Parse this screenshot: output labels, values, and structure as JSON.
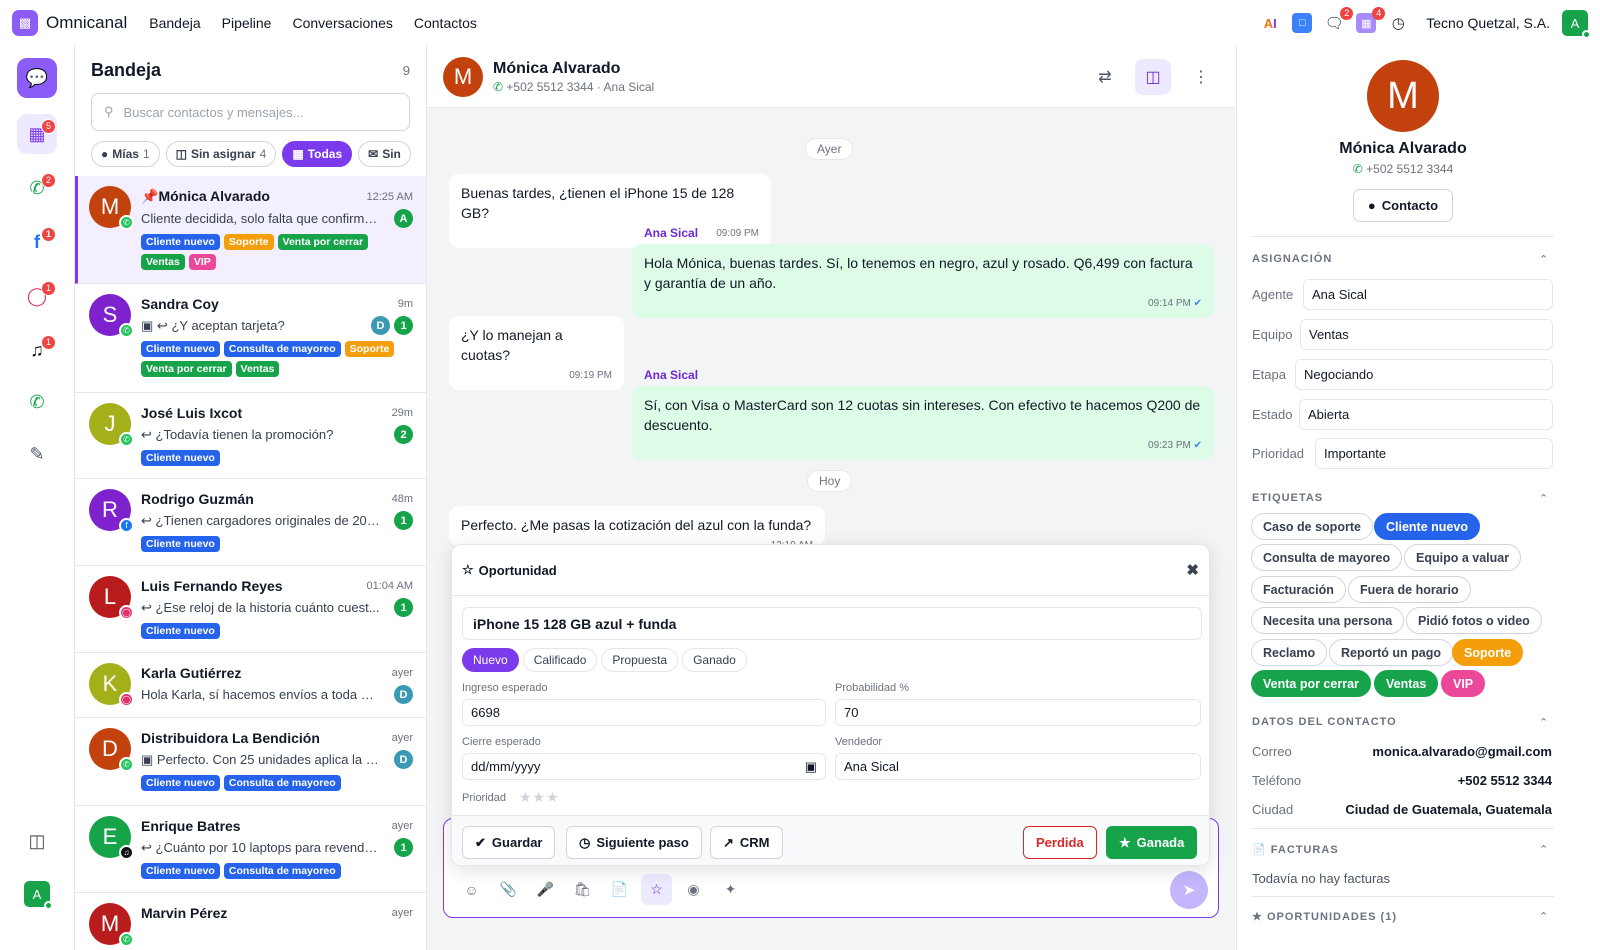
{
  "app": {
    "name": "Omnicanal",
    "company": "Tecno Quetzal, S.A.",
    "avatar_letter": "A",
    "brand_color": "#8b5cf6"
  },
  "topnav": [
    "Bandeja",
    "Pipeline",
    "Conversaciones",
    "Contactos"
  ],
  "top_badges": {
    "chat": "2",
    "apps": "4"
  },
  "rail_badges": {
    "inbox": "5",
    "whatsapp": "2",
    "facebook": "1",
    "instagram": "1",
    "tiktok": "1"
  },
  "inbox": {
    "title": "Bandeja",
    "count": "9",
    "search_placeholder": "Buscar contactos y mensajes...",
    "filters": [
      {
        "label": "Mías",
        "count": "1"
      },
      {
        "label": "Sin asignar",
        "count": "4"
      },
      {
        "label": "Todas",
        "count": ""
      },
      {
        "label": "Sin",
        "count": ""
      }
    ],
    "conversations": [
      {
        "name": "Mónica Alvarado",
        "time": "12:25 AM",
        "preview": "Cliente decidida, solo falta que confirme...",
        "avatar": "M",
        "color": "#c2410c",
        "channel": "whatsapp",
        "badge": "A",
        "tags": [
          [
            "Cliente nuevo",
            "blue"
          ],
          [
            "Soporte",
            "orange"
          ],
          [
            "Venta por cerrar",
            "green"
          ],
          [
            "Ventas",
            "green"
          ],
          [
            "VIP",
            "pink"
          ]
        ]
      },
      {
        "name": "Sandra Coy",
        "time": "9m",
        "preview": "¿Y aceptan tarjeta?",
        "avatar": "S",
        "color": "#7e22ce",
        "channel": "whatsapp",
        "badge": "D",
        "unread": "1",
        "tags": [
          [
            "Cliente nuevo",
            "blue"
          ],
          [
            "Consulta de mayoreo",
            "blue"
          ],
          [
            "Soporte",
            "orange"
          ],
          [
            "Venta por cerrar",
            "green"
          ],
          [
            "Ventas",
            "green"
          ]
        ]
      },
      {
        "name": "José Luis Ixcot",
        "time": "29m",
        "preview": "¿Todavía tienen la promoción?",
        "avatar": "J",
        "color": "#a3b01a",
        "channel": "whatsapp",
        "unread": "2",
        "tags": [
          [
            "Cliente nuevo",
            "blue"
          ]
        ]
      },
      {
        "name": "Rodrigo Guzmán",
        "time": "48m",
        "preview": "¿Tienen cargadores originales de 20 ...",
        "avatar": "R",
        "color": "#7e22ce",
        "channel": "facebook",
        "unread": "1",
        "tags": [
          [
            "Cliente nuevo",
            "blue"
          ]
        ]
      },
      {
        "name": "Luis Fernando Reyes",
        "time": "01:04 AM",
        "preview": "¿Ese reloj de la historia cuánto cuest...",
        "avatar": "L",
        "color": "#b91c1c",
        "channel": "instagram",
        "unread": "1",
        "tags": [
          [
            "Cliente nuevo",
            "blue"
          ]
        ]
      },
      {
        "name": "Karla Gutiérrez",
        "time": "ayer",
        "preview": "Hola Karla, sí hacemos envíos a toda Gu...",
        "avatar": "K",
        "color": "#a3b01a",
        "channel": "instagram",
        "badge": "D",
        "tags": []
      },
      {
        "name": "Distribuidora La Bendición",
        "time": "ayer",
        "preview": "Perfecto. Con 25 unidades aplica la lis...",
        "avatar": "D",
        "color": "#c2410c",
        "channel": "whatsapp",
        "badge": "D",
        "tags": [
          [
            "Cliente nuevo",
            "blue"
          ],
          [
            "Consulta de mayoreo",
            "blue"
          ]
        ]
      },
      {
        "name": "Enrique Batres",
        "time": "ayer",
        "preview": "¿Cuánto por 10 laptops para revende...",
        "avatar": "E",
        "color": "#16a34a",
        "channel": "tiktok",
        "unread": "1",
        "tags": [
          [
            "Cliente nuevo",
            "blue"
          ],
          [
            "Consulta de mayoreo",
            "blue"
          ]
        ]
      },
      {
        "name": "Marvin Pérez",
        "time": "ayer",
        "preview": "",
        "avatar": "M",
        "color": "#b91c1c",
        "channel": "whatsapp",
        "tags": []
      }
    ]
  },
  "chat": {
    "name": "Mónica Alvarado",
    "phone": "+502 5512 3344",
    "agent": "Ana Sical",
    "day1": "Ayer",
    "day2": "Hoy",
    "m1": {
      "text": "Buenas tardes, ¿tienen el iPhone 15 de 128 GB?",
      "time": "09:09 PM"
    },
    "m2": {
      "author": "Ana Sical",
      "text": "Hola Mónica, buenas tardes. Sí, lo tenemos en negro, azul y rosado. Q6,499 con factura y garantía de un año.",
      "time": "09:14 PM"
    },
    "m3": {
      "text": "¿Y lo manejan a cuotas?",
      "time": "09:19 PM"
    },
    "m4": {
      "author": "Ana Sical",
      "text": "Sí, con Visa o MasterCard son 12 cuotas sin intereses. Con efectivo te hacemos Q200 de descuento.",
      "time": "09:23 PM"
    },
    "m5": {
      "text": "Perfecto. ¿Me pasas la cotización del azul con la funda?",
      "time": "12:19 AM"
    }
  },
  "opportunity": {
    "title": "Oportunidad",
    "name": "iPhone 15 128 GB azul + funda",
    "stages": [
      "Nuevo",
      "Calificado",
      "Propuesta",
      "Ganado"
    ],
    "active_stage": "Nuevo",
    "revenue_label": "Ingreso esperado",
    "revenue": "6698",
    "prob_label": "Probabilidad %",
    "prob": "70",
    "close_label": "Cierre esperado",
    "close_placeholder": "dd/mm/yyyy",
    "seller_label": "Vendedor",
    "seller": "Ana Sical",
    "priority_label": "Prioridad",
    "priority_stars": 0,
    "save": "Guardar",
    "next": "Siguiente paso",
    "crm": "CRM",
    "lost": "Perdida",
    "won": "Ganada"
  },
  "contact": {
    "avatar": "M",
    "name": "Mónica Alvarado",
    "phone": "+502 5512 3344",
    "button": "Contacto",
    "assignment_title": "ASIGNACIÓN",
    "assignment": [
      {
        "label": "Agente",
        "value": "Ana Sical"
      },
      {
        "label": "Equipo",
        "value": "Ventas"
      },
      {
        "label": "Etapa",
        "value": "Negociando"
      },
      {
        "label": "Estado",
        "value": "Abierta"
      },
      {
        "label": "Prioridad",
        "value": "Importante"
      }
    ],
    "tags_title": "ETIQUETAS",
    "tags": [
      [
        "Caso de soporte",
        ""
      ],
      [
        "Cliente nuevo",
        "blue"
      ],
      [
        "Consulta de mayoreo",
        ""
      ],
      [
        "Equipo a valuar",
        ""
      ],
      [
        "Facturación",
        ""
      ],
      [
        "Fuera de horario",
        ""
      ],
      [
        "Necesita una persona",
        ""
      ],
      [
        "Pidió fotos o video",
        ""
      ],
      [
        "Reclamo",
        ""
      ],
      [
        "Reportó un pago",
        ""
      ],
      [
        "Soporte",
        "orange"
      ],
      [
        "Venta por cerrar",
        "green"
      ],
      [
        "Ventas",
        "green"
      ],
      [
        "VIP",
        "pink"
      ]
    ],
    "data_title": "DATOS DEL CONTACTO",
    "data": [
      {
        "label": "Correo",
        "value": "monica.alvarado@gmail.com"
      },
      {
        "label": "Teléfono",
        "value": "+502 5512 3344"
      },
      {
        "label": "Ciudad",
        "value": "Ciudad de Guatemala, Guatemala"
      }
    ],
    "invoices_title": "FACTURAS",
    "invoices_empty": "Todavía no hay facturas",
    "opps_title": "OPORTUNIDADES (1)"
  }
}
